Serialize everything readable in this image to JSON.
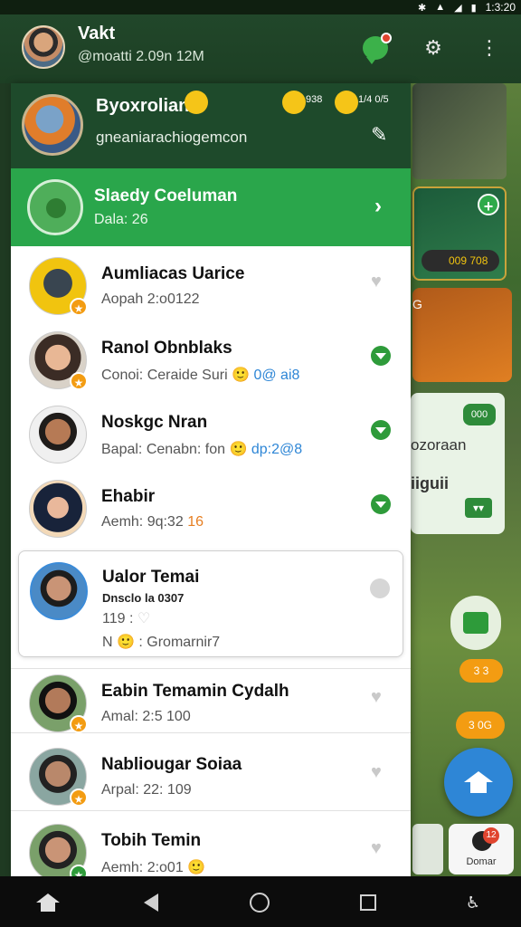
{
  "status_bar": {
    "time": "1:3:20",
    "icons": [
      "bluetooth-icon",
      "wifi-icon",
      "signal-icon",
      "battery-icon"
    ]
  },
  "app_bar": {
    "title": "Vakt",
    "subtitle": "@moatti 2.09n 12M",
    "icons": [
      "chat-icon",
      "gear-icon",
      "more-vert-icon"
    ]
  },
  "drawer": {
    "header": {
      "name": "Byoxrolian",
      "handle": "gneaniarachiogemcon",
      "count_1": "938",
      "count_2": "1/4 0/5"
    },
    "banner": {
      "title": "Slaedy Coeluman",
      "subtitle": "Dala: 26"
    },
    "contacts": [
      {
        "name": "Aumliacas Uarice",
        "meta": "Aopah 2:o0122",
        "action": "heart-icon"
      },
      {
        "name": "Ranol Obnblaks",
        "meta_prefix": "Conoi: Ceraide Suri",
        "meta_suffix": "0@ ai8",
        "action": "down-arrow-icon"
      },
      {
        "name": "Noskgc Nran",
        "meta_prefix": "Bapal: Cenabn: fon",
        "meta_suffix": "dp:2@8",
        "action": "down-arrow-icon"
      },
      {
        "name": "Ehabir",
        "meta_prefix": "Aemh: 9q:32",
        "meta_suffix": "16",
        "action": "down-arrow-icon"
      },
      {
        "name": "Eabin Temamin Cydalh",
        "meta": "Amal: 2:5 100",
        "action": "heart-icon"
      },
      {
        "name": "Nabliougar Soiaa",
        "meta": "Arpal: 22: 109",
        "action": "heart-icon"
      },
      {
        "name": "Tobih Temin",
        "meta": "Aemh: 2:o01",
        "action": "heart-icon"
      }
    ],
    "selected": {
      "name": "Ualor Temai",
      "line_1": "Dnsclo la 0307",
      "line_2": "119 :",
      "line_3_prefix": "N",
      "line_3_suffix": ": Gromarnir7"
    }
  },
  "side_panel": {
    "card_b_badge": "009 708",
    "card_c_label": "G",
    "card_d_pill": "000",
    "card_d_text_1": "ozoraan",
    "card_d_text_2": "iiguii",
    "coin_1": "3 3",
    "coin_2": "3 0G",
    "tile_label": "Domar",
    "tile_badge": "12"
  },
  "nav_bar": [
    "home-icon",
    "back-icon",
    "home-circle-icon",
    "recents-icon",
    "accessibility-icon"
  ]
}
